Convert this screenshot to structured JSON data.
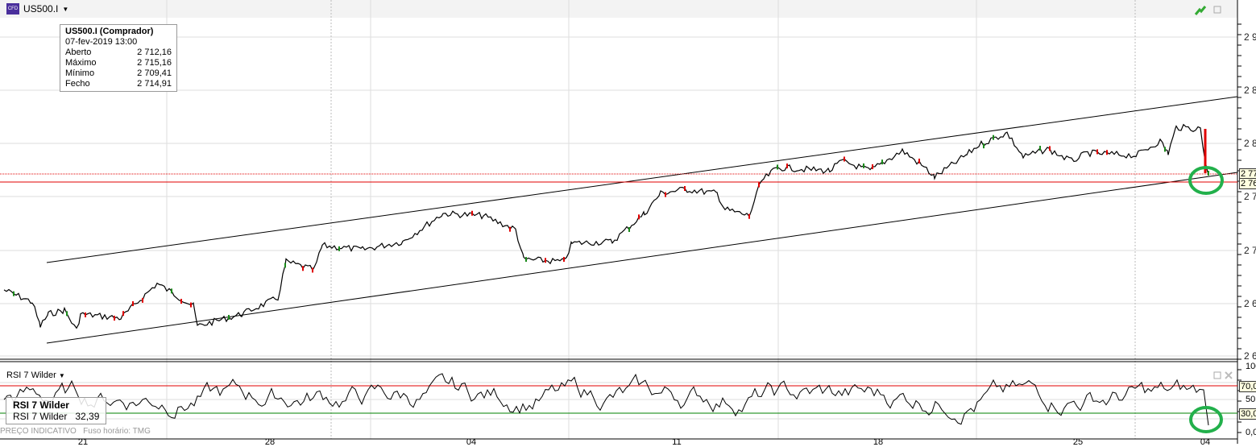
{
  "header": {
    "symbol": "US500.I"
  },
  "tooltip": {
    "title": "US500.I (Comprador)",
    "date": "07-fev-2019 13:00",
    "rows": [
      {
        "label": "Aberto",
        "value": "2 712,16"
      },
      {
        "label": "Máximo",
        "value": "2 715,16"
      },
      {
        "label": "Mínimo",
        "value": "2 709,41"
      },
      {
        "label": "Fecho",
        "value": "2 714,91"
      }
    ]
  },
  "price_axis": [
    "2 9",
    "2 8",
    "2 8",
    "2 7",
    "2 7",
    "2 6",
    "2 6"
  ],
  "price_labels": [
    "2 77",
    "2 76"
  ],
  "rsi": {
    "name": "RSI 7 Wilder",
    "tip_title": "RSI 7 Wilder",
    "tip_label": "RSI 7 Wilder",
    "tip_value": "32,39",
    "axis": [
      "100",
      "70,0",
      "50,",
      "30,0",
      "0,0"
    ]
  },
  "footer": {
    "text": "PREÇO INDICATIVO   Fuso horário: TMG"
  },
  "x_axis": [
    "21",
    "28",
    "04",
    "11",
    "18",
    "25",
    "04"
  ],
  "colors": {
    "upper": "#e00000",
    "lower": "#008000",
    "highlight": "#22b04b"
  }
}
